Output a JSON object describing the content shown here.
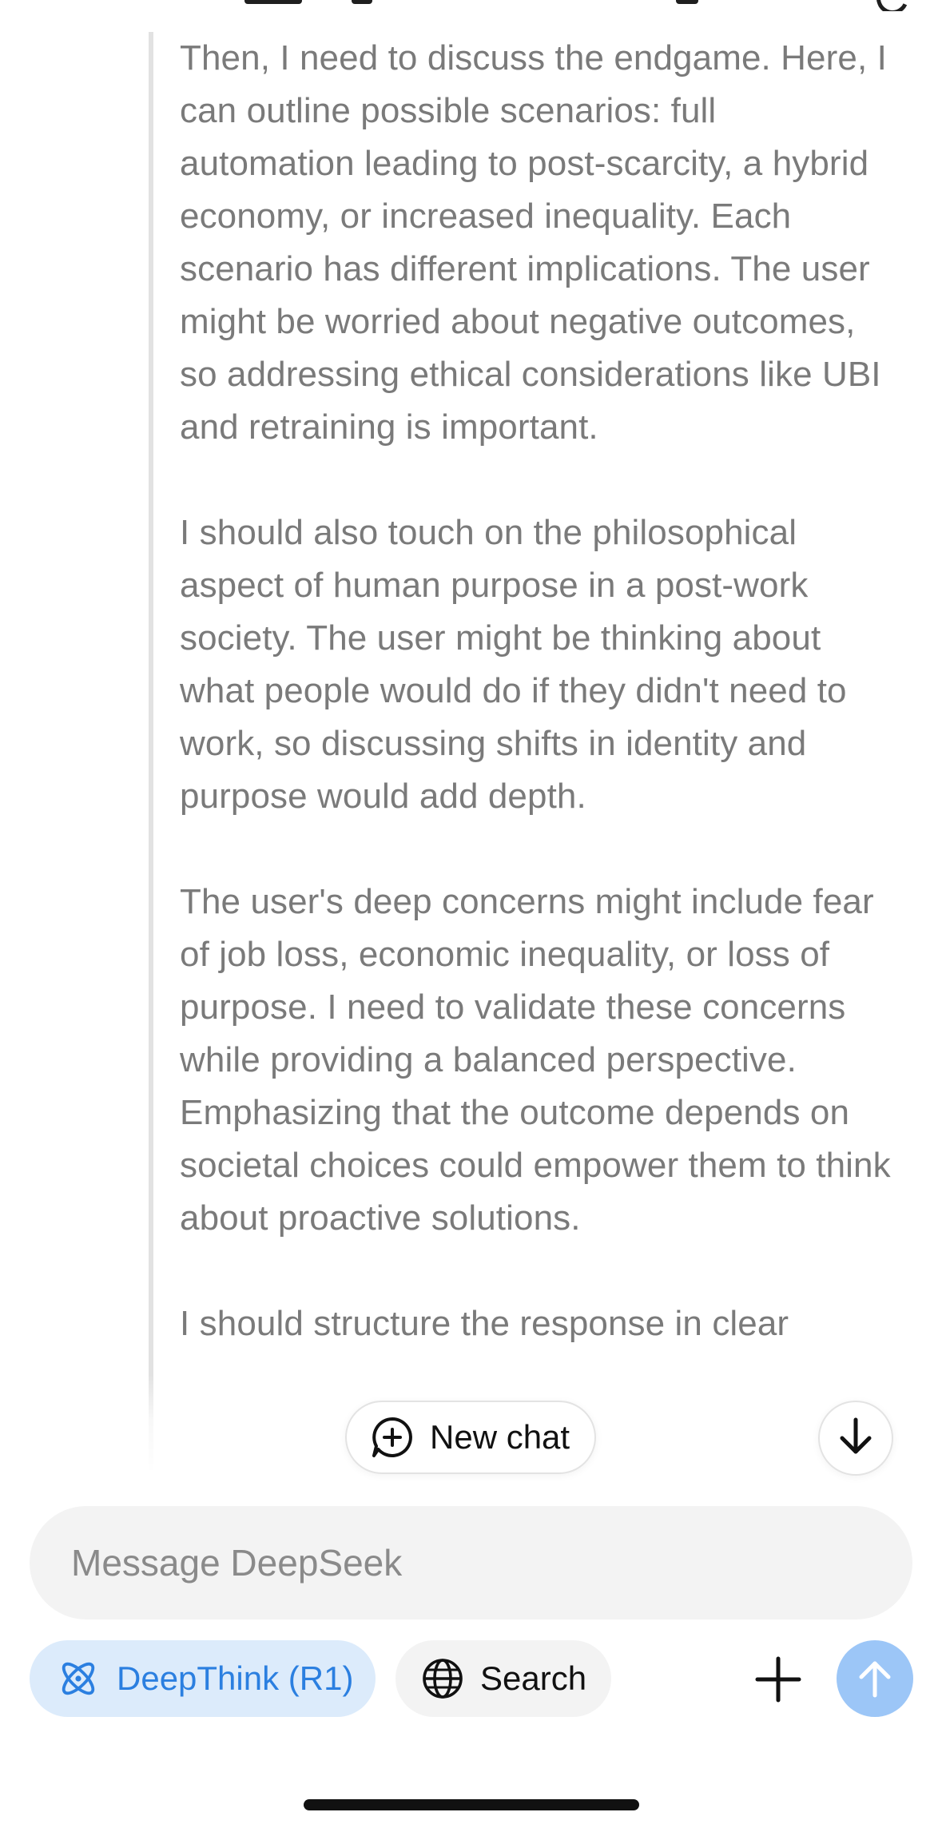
{
  "thinking": {
    "paragraphs": [
      "Then, I need to discuss the endgame. Here, I can outline possible scenarios: full automation leading to post-scarcity, a hybrid economy, or increased inequality. Each scenario has different implications. The user might be worried about negative outcomes, so addressing ethical considerations like UBI and retraining is important.",
      "I should also touch on the philosophical aspect of human purpose in a post-work society. The user might be thinking about what people would do if they didn't need to work, so discussing shifts in identity and purpose would add depth.",
      "The user's deep concerns might include fear of job loss, economic inequality, or loss of purpose. I need to validate these concerns while providing a balanced perspective. Emphasizing that the outcome depends on societal choices could empower them to think about proactive solutions.",
      "I should structure the response in clear"
    ]
  },
  "floating": {
    "new_chat_label": "New chat"
  },
  "composer": {
    "placeholder": "Message DeepSeek",
    "deepthink_label": "DeepThink (R1)",
    "search_label": "Search"
  },
  "colors": {
    "accent": "#2b7fe0",
    "deepthink_bg": "#dcebfb",
    "send_button": "#9cc6f7",
    "thinking_text": "#7a7a7a",
    "composer_bg": "#f3f3f3"
  },
  "icons": {
    "new_chat": "chat-plus-icon",
    "scroll_down": "arrow-down-icon",
    "deepthink": "atom-icon",
    "search": "globe-icon",
    "attach": "plus-icon",
    "send": "arrow-up-icon"
  }
}
